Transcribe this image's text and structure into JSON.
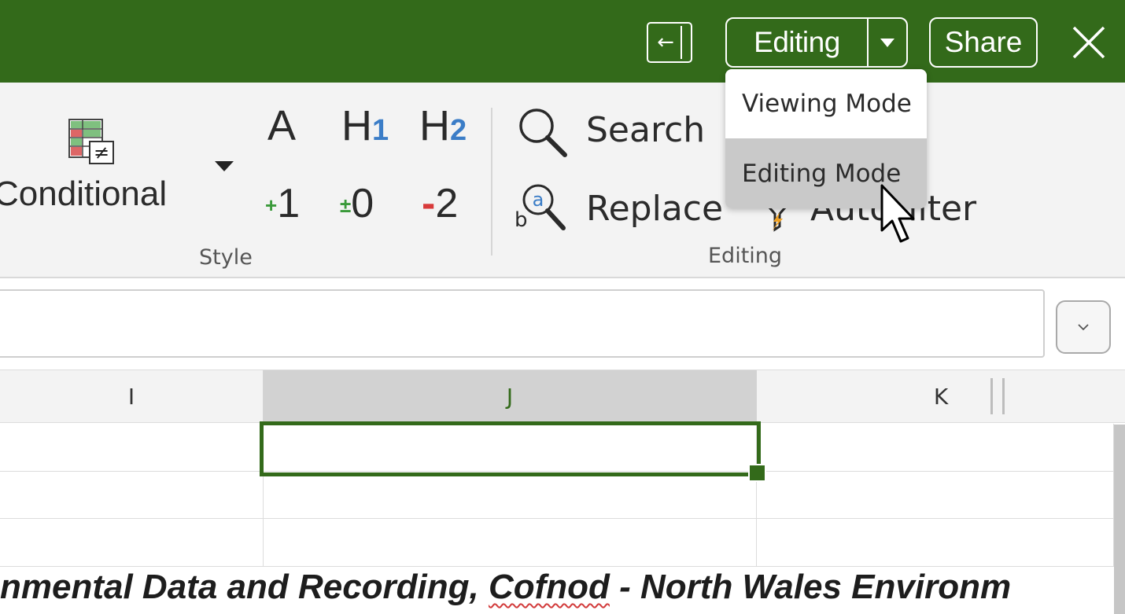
{
  "titlebar": {
    "bg_color": "#336a1a",
    "sidebar_toggle_icon": "collapse-left-icon",
    "mode_button_label": "Editing",
    "share_label": "Share",
    "close_icon": "close-icon"
  },
  "ribbon": {
    "style_group": {
      "conditional_label": "Conditional",
      "heading_a": "A",
      "heading_h1_letter": "H",
      "heading_h1_num": "1",
      "heading_h2_letter": "H",
      "heading_h2_num": "2",
      "plus1_sign": "+",
      "plus1_num": "1",
      "zero_sign": "±",
      "zero_num": "0",
      "minus2_sign": "-",
      "minus2_num": "2",
      "group_label": "Style"
    },
    "editing_group": {
      "search_label": "Search",
      "replace_label": "Replace",
      "autofilter_label": "AutoFilter",
      "group_label": "Editing"
    }
  },
  "mode_menu": {
    "items": [
      {
        "label": "Viewing Mode",
        "active": false
      },
      {
        "label": "Editing Mode",
        "active": true
      }
    ]
  },
  "grid": {
    "columns": [
      "I",
      "J",
      "K"
    ],
    "selected_column": "J",
    "accent_color": "#336a1a",
    "visible_text_start": "nmental Data and Recording, ",
    "visible_text_misspelled": "Cofnod",
    "visible_text_end": " - North Wales Environm"
  }
}
